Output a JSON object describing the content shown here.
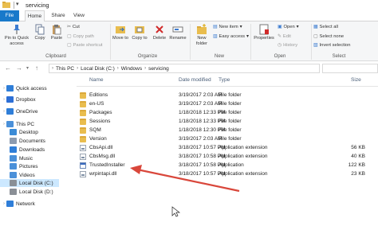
{
  "window": {
    "title": "servicing"
  },
  "tabs": [
    "File",
    "Home",
    "Share",
    "View"
  ],
  "ribbon": {
    "clipboard": {
      "label": "Clipboard",
      "pin": "Pin to Quick access",
      "copy": "Copy",
      "paste": "Paste",
      "cut": "Cut",
      "copy_path": "Copy path",
      "paste_shortcut": "Paste shortcut"
    },
    "organize": {
      "label": "Organize",
      "move_to": "Move to",
      "copy_to": "Copy to",
      "delete": "Delete",
      "rename": "Rename"
    },
    "new": {
      "label": "New",
      "new_folder": "New folder",
      "new_item": "New item",
      "easy_access": "Easy access"
    },
    "open": {
      "label": "Open",
      "properties": "Properties",
      "open": "Open",
      "edit": "Edit",
      "history": "History"
    },
    "select": {
      "label": "Select",
      "select_all": "Select all",
      "select_none": "Select none",
      "invert_selection": "Invert selection"
    }
  },
  "address": {
    "crumbs": [
      "This PC",
      "Local Disk (C:)",
      "Windows",
      "servicing"
    ]
  },
  "columns": {
    "name": "Name",
    "date_modified": "Date modified",
    "type": "Type",
    "size": "Size"
  },
  "nav": {
    "items": [
      {
        "label": "Quick access",
        "icon": "star-icon",
        "indent": 0
      },
      {
        "label": "Dropbox",
        "icon": "dropbox-icon",
        "indent": 0
      },
      {
        "label": "OneDrive",
        "icon": "cloud-icon",
        "indent": 0
      },
      {
        "label": "This PC",
        "icon": "computer-icon",
        "indent": 0
      },
      {
        "label": "Desktop",
        "icon": "desktop-icon",
        "indent": 1
      },
      {
        "label": "Documents",
        "icon": "documents-icon",
        "indent": 1
      },
      {
        "label": "Downloads",
        "icon": "downloads-icon",
        "indent": 1
      },
      {
        "label": "Music",
        "icon": "music-icon",
        "indent": 1
      },
      {
        "label": "Pictures",
        "icon": "pictures-icon",
        "indent": 1
      },
      {
        "label": "Videos",
        "icon": "videos-icon",
        "indent": 1
      },
      {
        "label": "Local Disk (C:)",
        "icon": "drive-icon",
        "indent": 1,
        "selected": true
      },
      {
        "label": "Local Disk (D:)",
        "icon": "drive-icon",
        "indent": 1
      },
      {
        "label": "Network",
        "icon": "network-icon",
        "indent": 0
      }
    ]
  },
  "files": [
    {
      "name": "Editions",
      "date": "3/19/2017 2:03 AM",
      "type": "File folder",
      "size": "",
      "kind": "folder"
    },
    {
      "name": "en-US",
      "date": "3/19/2017 2:03 AM",
      "type": "File folder",
      "size": "",
      "kind": "folder"
    },
    {
      "name": "Packages",
      "date": "1/18/2018 12:33 PM",
      "type": "File folder",
      "size": "",
      "kind": "folder"
    },
    {
      "name": "Sessions",
      "date": "1/18/2018 12:33 PM",
      "type": "File folder",
      "size": "",
      "kind": "folder"
    },
    {
      "name": "SQM",
      "date": "1/18/2018 12:30 PM",
      "type": "File folder",
      "size": "",
      "kind": "folder"
    },
    {
      "name": "Version",
      "date": "3/19/2017 2:03 AM",
      "type": "File folder",
      "size": "",
      "kind": "folder"
    },
    {
      "name": "CbsApi.dll",
      "date": "3/18/2017 10:57 PM",
      "type": "Application extension",
      "size": "56 KB",
      "kind": "dll"
    },
    {
      "name": "CbsMsg.dll",
      "date": "3/18/2017 10:58 PM",
      "type": "Application extension",
      "size": "40 KB",
      "kind": "dll"
    },
    {
      "name": "TrustedInstaller",
      "date": "3/18/2017 10:58 PM",
      "type": "Application",
      "size": "122 KB",
      "kind": "exe"
    },
    {
      "name": "wrpintapi.dll",
      "date": "3/18/2017 10:57 PM",
      "type": "Application extension",
      "size": "23 KB",
      "kind": "dll"
    }
  ],
  "colors": {
    "file_tab": "#1979ca",
    "selected_nav": "#cce8ff",
    "annotation_arrow": "#d9473b",
    "folder": "#e9bd4e"
  }
}
